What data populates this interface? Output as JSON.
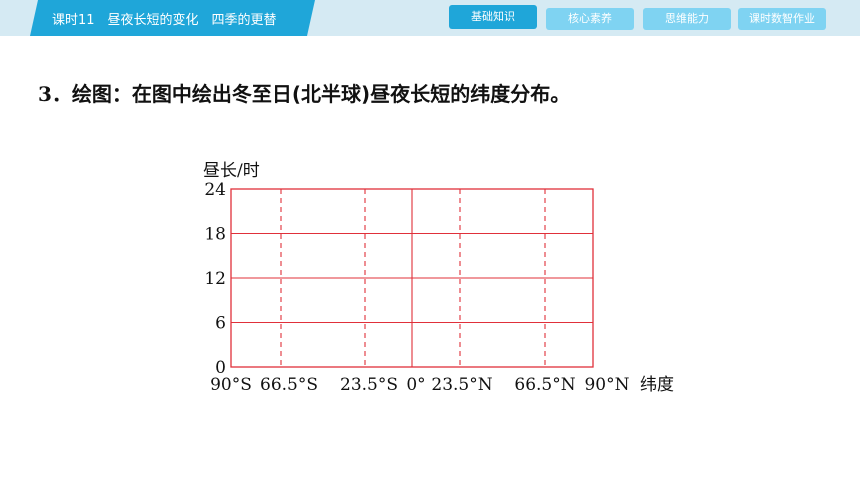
{
  "header": {
    "lesson_title": "课时11　昼夜长短的变化　四季的更替",
    "tabs": [
      {
        "label": "基础知识",
        "active": true
      },
      {
        "label": "核心素养",
        "active": false
      },
      {
        "label": "思维能力",
        "active": false
      },
      {
        "label": "课时数智作业",
        "active": false
      }
    ]
  },
  "question": {
    "number": "3．",
    "text": "绘图：在图中绘出冬至日(北半球)昼夜长短的纬度分布。"
  },
  "colors": {
    "banner": "#1fa6d9",
    "tab_inactive": "#7fd3f2",
    "grid": "#e0303a"
  },
  "chart_data": {
    "type": "line",
    "ylabel": "昼长/时",
    "xlabel": "纬度",
    "yticks": [
      "24",
      "18",
      "12",
      "6",
      "0"
    ],
    "ylim": [
      0,
      24
    ],
    "xticks": [
      "90°S",
      "66.5°S",
      "23.5°S",
      "0°",
      "23.5°N",
      "66.5°N",
      "90°N"
    ],
    "series": []
  }
}
